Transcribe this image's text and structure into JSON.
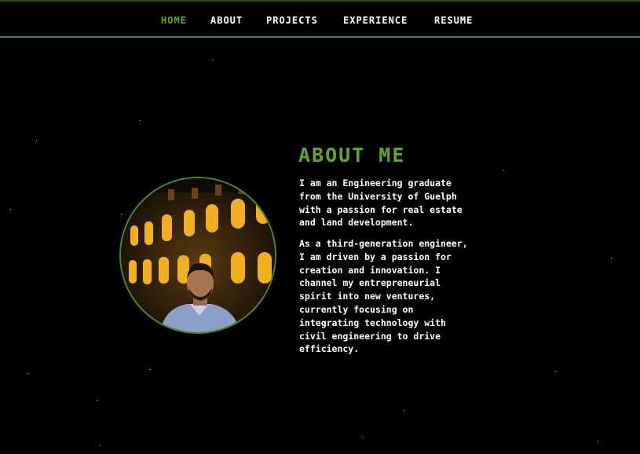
{
  "nav": {
    "items": [
      {
        "label": "HOME",
        "active": true
      },
      {
        "label": "ABOUT",
        "active": false
      },
      {
        "label": "PROJECTS",
        "active": false
      },
      {
        "label": "EXPERIENCE",
        "active": false
      },
      {
        "label": "RESUME",
        "active": false
      }
    ]
  },
  "about": {
    "heading": "ABOUT ME",
    "paragraph_1": "I am an Engineering graduate\nfrom the University of Guelph\nwith a passion for real estate\nand land development.",
    "paragraph_2": "As a third-generation engineer,\nI am driven by a passion for\ncreation and innovation. I\nchannel my entrepreneurial\nspirit into new ventures,\ncurrently focusing on\nintegrating technology with\ncivil engineering to drive\nefficiency."
  },
  "colors": {
    "accent": "#5ea821",
    "border": "#4a8a1e",
    "background": "#000000",
    "text": "#ffffff"
  },
  "icons": [
    "profile-photo"
  ]
}
